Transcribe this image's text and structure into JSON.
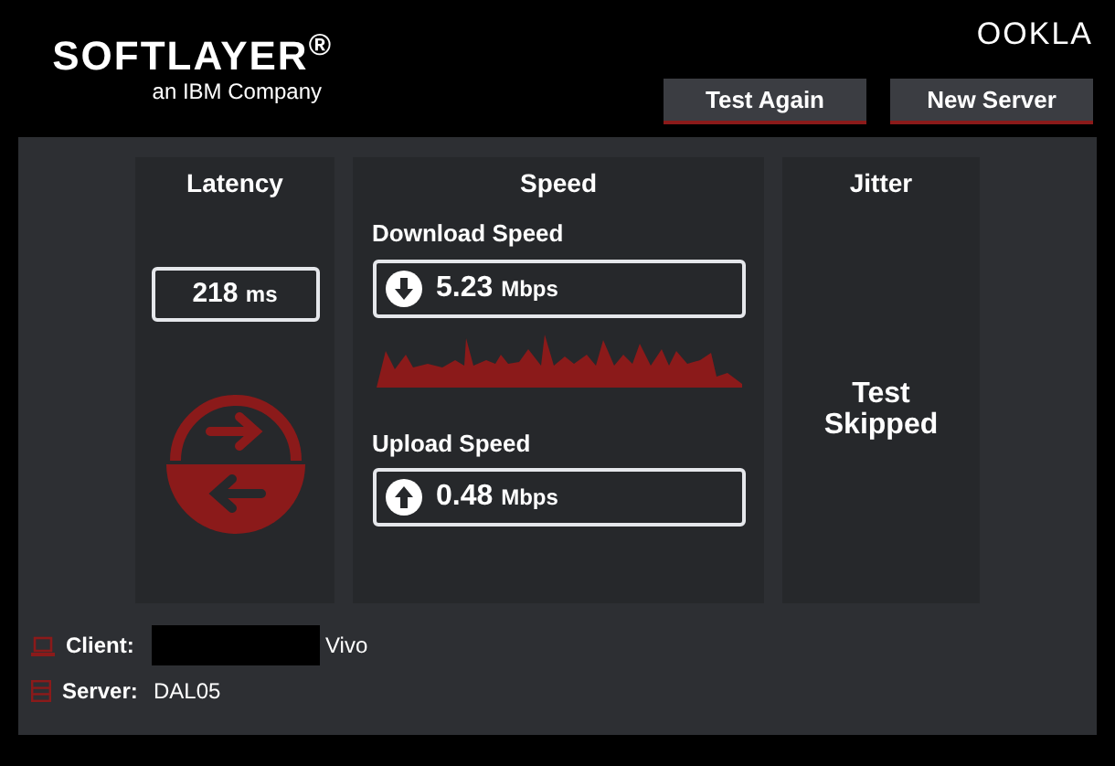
{
  "header": {
    "logo": "SOFTLAYER$^{®}$",
    "tagline": "an IBM Company",
    "brand": "OOKLA",
    "buttons": [
      "Test Again",
      "New Server"
    ]
  },
  "latency": {
    "title": "Latency",
    "value": "218",
    "unit": "ms"
  },
  "speed": {
    "title": "Speed",
    "tests": [
      {
        "kind": "download",
        "label": "Download Speed",
        "value": "5.23",
        "unit": "Mbps"
      },
      {
        "kind": "upload",
        "label": "Upload Speed",
        "value": "0.48",
        "unit": "Mbps"
      }
    ]
  },
  "jitter": {
    "title": "Jitter",
    "message": "Test Skipped"
  },
  "footer": [
    {
      "kind": "client",
      "label": "Client:",
      "value": "Vivo",
      "redacted": true
    },
    {
      "kind": "server",
      "label": "Server:",
      "value": "DAL05",
      "redacted": false
    }
  ]
}
